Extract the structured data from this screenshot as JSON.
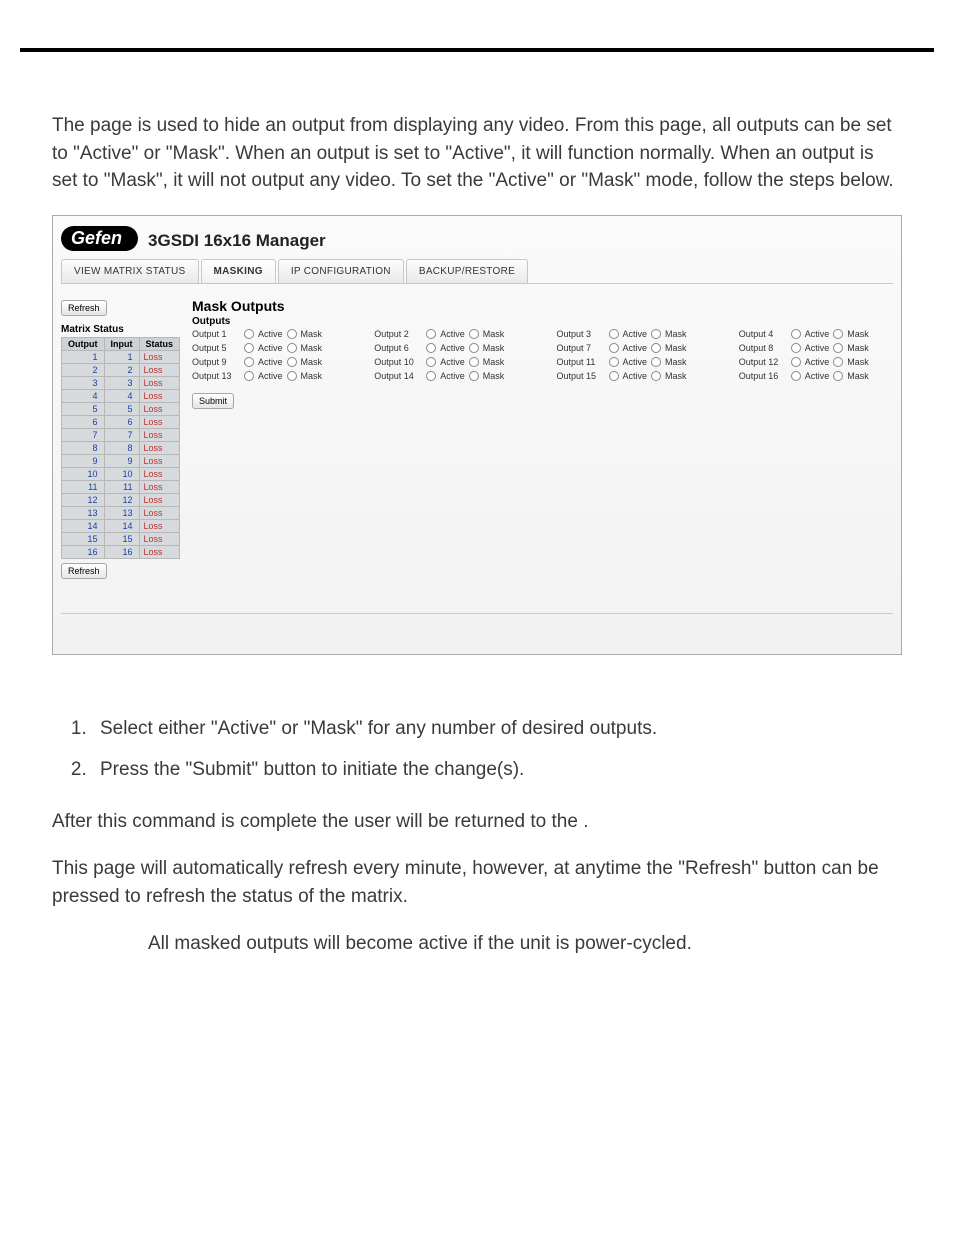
{
  "intro": "The                   page is used to hide an output from displaying any video. From this page, all outputs can be set to \"Active\" or \"Mask\". When an output is set to \"Active\", it will function normally. When an output is set to \"Mask\", it will not output any video. To set the \"Active\" or \"Mask\" mode, follow the steps below.",
  "brand": {
    "badge": "Gefen",
    "title": "3GSDI 16x16 Manager"
  },
  "tabs": {
    "view": "VIEW MATRIX STATUS",
    "masking": "MASKING",
    "ip": "IP CONFIGURATION",
    "backup": "BACKUP/RESTORE"
  },
  "buttons": {
    "refresh": "Refresh",
    "submit": "Submit"
  },
  "titles": {
    "mask_outputs": "Mask Outputs",
    "outputs": "Outputs",
    "matrix_status": "Matrix Status"
  },
  "status_headers": {
    "output": "Output",
    "input": "Input",
    "status": "Status"
  },
  "status_rows": [
    {
      "o": "1",
      "i": "1",
      "s": "Loss"
    },
    {
      "o": "2",
      "i": "2",
      "s": "Loss"
    },
    {
      "o": "3",
      "i": "3",
      "s": "Loss"
    },
    {
      "o": "4",
      "i": "4",
      "s": "Loss"
    },
    {
      "o": "5",
      "i": "5",
      "s": "Loss"
    },
    {
      "o": "6",
      "i": "6",
      "s": "Loss"
    },
    {
      "o": "7",
      "i": "7",
      "s": "Loss"
    },
    {
      "o": "8",
      "i": "8",
      "s": "Loss"
    },
    {
      "o": "9",
      "i": "9",
      "s": "Loss"
    },
    {
      "o": "10",
      "i": "10",
      "s": "Loss"
    },
    {
      "o": "11",
      "i": "11",
      "s": "Loss"
    },
    {
      "o": "12",
      "i": "12",
      "s": "Loss"
    },
    {
      "o": "13",
      "i": "13",
      "s": "Loss"
    },
    {
      "o": "14",
      "i": "14",
      "s": "Loss"
    },
    {
      "o": "15",
      "i": "15",
      "s": "Loss"
    },
    {
      "o": "16",
      "i": "16",
      "s": "Loss"
    }
  ],
  "radio_labels": {
    "active": "Active",
    "mask": "Mask"
  },
  "outputs": [
    "Output 1",
    "Output 2",
    "Output 3",
    "Output 4",
    "Output 5",
    "Output 6",
    "Output 7",
    "Output 8",
    "Output 9",
    "Output 10",
    "Output 11",
    "Output 12",
    "Output 13",
    "Output 14",
    "Output 15",
    "Output 16"
  ],
  "steps": {
    "s1": "Select either \"Active\" or \"Mask\" for any number of desired outputs.",
    "s2": "Press the \"Submit\" button to initiate the change(s)."
  },
  "after": "After this command is complete the user will be returned to the                         .",
  "auto": "This page will automatically refresh every minute, however, at anytime the \"Refresh\" button can be pressed to refresh the status of the matrix.",
  "note": "All masked outputs will become active if the unit is power-cycled."
}
